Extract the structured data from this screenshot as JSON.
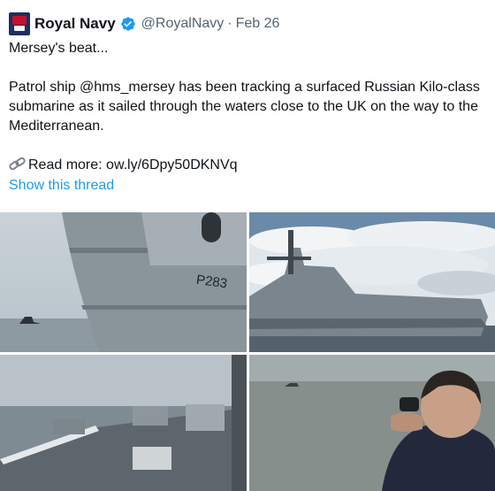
{
  "tweet": {
    "display_name": "Royal Navy",
    "handle": "@RoyalNavy",
    "separator": "·",
    "date": "Feb 26",
    "text_line1": "Mersey's beat...",
    "text_para2": "Patrol ship @hms_mersey has been tracking a surfaced Russian Kilo-class submarine as it sailed through the waters close to the UK on the way to the Mediterranean.",
    "read_more": "Read more: ow.ly/6Dpy50DKNVq",
    "show_thread": "Show this thread"
  },
  "media": {
    "hull_number": "P283"
  },
  "icons": {
    "verified": "verified-badge-icon",
    "link": "link-icon"
  },
  "colors": {
    "link_blue": "#1d9bf0",
    "secondary_text": "#536471",
    "primary_text": "#0f1419"
  }
}
